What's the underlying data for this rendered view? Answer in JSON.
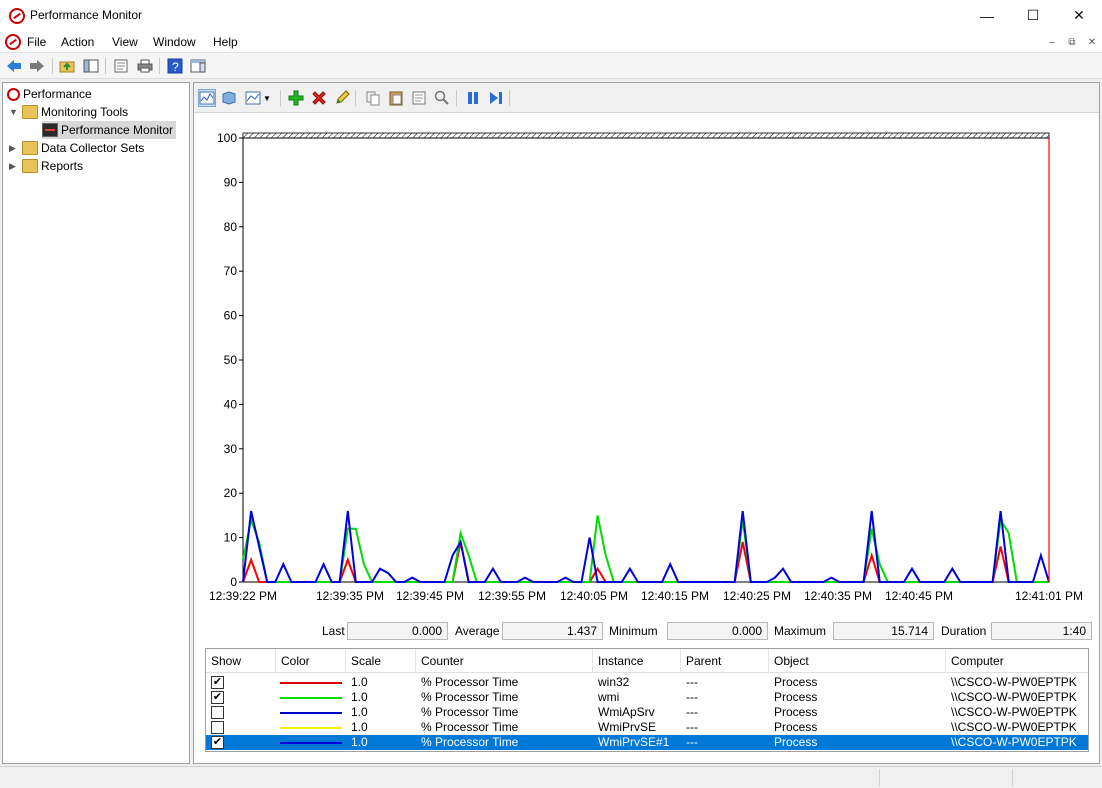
{
  "window": {
    "title": "Performance Monitor"
  },
  "menu": {
    "items": [
      "File",
      "Action",
      "View",
      "Window",
      "Help"
    ]
  },
  "tree": {
    "items": [
      {
        "label": "Performance"
      },
      {
        "label": "Monitoring Tools"
      },
      {
        "label": "Performance Monitor"
      },
      {
        "label": "Data Collector Sets"
      },
      {
        "label": "Reports"
      }
    ]
  },
  "chart_data": {
    "type": "line",
    "title": "",
    "xlabel": "",
    "ylabel": "",
    "ylim": [
      0,
      100
    ],
    "yticks": [
      0,
      10,
      20,
      30,
      40,
      50,
      60,
      70,
      80,
      90,
      100
    ],
    "xticks": [
      "12:39:22 PM",
      "12:39:35 PM",
      "12:39:45 PM",
      "12:39:55 PM",
      "12:40:05 PM",
      "12:40:15 PM",
      "12:40:25 PM",
      "12:40:35 PM",
      "12:40:45 PM",
      "12:41:01 PM"
    ],
    "grid": false,
    "series": [
      {
        "name": "win32",
        "color": "#ff0000",
        "values": [
          0,
          5,
          0,
          0,
          0,
          0,
          0,
          0,
          0,
          0,
          0,
          0,
          0,
          5,
          0,
          0,
          0,
          0,
          0,
          0,
          0,
          0,
          0,
          0,
          0,
          0,
          0,
          9,
          0,
          0,
          0,
          0,
          0,
          0,
          0,
          0,
          0,
          0,
          0,
          0,
          0,
          0,
          0,
          0,
          3,
          0,
          0,
          0,
          0,
          0,
          0,
          0,
          0,
          0,
          0,
          0,
          0,
          0,
          0,
          0,
          0,
          0,
          9,
          0,
          0,
          0,
          0,
          0,
          0,
          0,
          0,
          0,
          0,
          0,
          0,
          0,
          0,
          0,
          6,
          0,
          0,
          0,
          0,
          0,
          0,
          0,
          0,
          0,
          0,
          0,
          0,
          0,
          0,
          0,
          8,
          0,
          0,
          0,
          0,
          0,
          0
        ]
      },
      {
        "name": "wmi",
        "color": "#00dd00",
        "values": [
          5,
          14,
          9,
          0,
          0,
          0,
          0,
          0,
          0,
          0,
          0,
          0,
          0,
          12,
          12,
          4,
          0,
          0,
          0,
          0,
          0,
          0,
          0,
          0,
          0,
          0,
          0,
          11,
          6,
          0,
          0,
          0,
          0,
          0,
          0,
          0,
          0,
          0,
          0,
          0,
          0,
          0,
          0,
          0,
          15,
          6,
          0,
          0,
          0,
          0,
          0,
          0,
          0,
          0,
          0,
          0,
          0,
          0,
          0,
          0,
          0,
          0,
          14,
          0,
          0,
          0,
          0,
          0,
          0,
          0,
          0,
          0,
          0,
          0,
          0,
          0,
          0,
          0,
          12,
          4,
          0,
          0,
          0,
          0,
          0,
          0,
          0,
          0,
          0,
          0,
          0,
          0,
          0,
          0,
          14,
          11,
          0,
          0,
          0,
          0,
          0
        ]
      },
      {
        "name": "WmiApSrv",
        "color": "#0000cc",
        "visible": false,
        "values": []
      },
      {
        "name": "WmiPrvSE",
        "color": "#ffff00",
        "visible": false,
        "values": []
      },
      {
        "name": "WmiPrvSE#1",
        "color": "#0000dd",
        "values": [
          0,
          16,
          8,
          0,
          0,
          4,
          0,
          0,
          0,
          0,
          4,
          0,
          0,
          16,
          0,
          0,
          0,
          3,
          2,
          0,
          0,
          1,
          0,
          0,
          0,
          0,
          6,
          9,
          0,
          0,
          0,
          3,
          0,
          0,
          0,
          1,
          0,
          0,
          0,
          0,
          1,
          0,
          0,
          10,
          0,
          0,
          0,
          0,
          3,
          0,
          0,
          0,
          0,
          4,
          0,
          0,
          0,
          0,
          0,
          0,
          0,
          0,
          16,
          0,
          0,
          0,
          1,
          3,
          0,
          0,
          0,
          0,
          0,
          1,
          0,
          0,
          0,
          0,
          16,
          0,
          0,
          0,
          0,
          3,
          0,
          0,
          0,
          0,
          3,
          0,
          0,
          0,
          0,
          0,
          16,
          0,
          0,
          0,
          0,
          6,
          0
        ]
      }
    ]
  },
  "stats": {
    "last_label": "Last",
    "last": "0.000",
    "average_label": "Average",
    "average": "1.437",
    "minimum_label": "Minimum",
    "minimum": "0.000",
    "maximum_label": "Maximum",
    "maximum": "15.714",
    "duration_label": "Duration",
    "duration": "1:40"
  },
  "legend": {
    "columns": [
      "Show",
      "Color",
      "Scale",
      "Counter",
      "Instance",
      "Parent",
      "Object",
      "Computer"
    ],
    "rows": [
      {
        "show": "✔",
        "color": "#e00000",
        "scale": "1.0",
        "counter": "% Processor Time",
        "instance": "win32",
        "parent": "---",
        "object": "Process",
        "computer": "\\\\CSCO-W-PW0EPTPK"
      },
      {
        "show": "✔",
        "color": "#00e000",
        "scale": "1.0",
        "counter": "% Processor Time",
        "instance": "wmi",
        "parent": "---",
        "object": "Process",
        "computer": "\\\\CSCO-W-PW0EPTPK"
      },
      {
        "show": "",
        "color": "#0000cc",
        "scale": "1.0",
        "counter": "% Processor Time",
        "instance": "WmiApSrv",
        "parent": "---",
        "object": "Process",
        "computer": "\\\\CSCO-W-PW0EPTPK"
      },
      {
        "show": "",
        "color": "#f0f000",
        "scale": "1.0",
        "counter": "% Processor Time",
        "instance": "WmiPrvSE",
        "parent": "---",
        "object": "Process",
        "computer": "\\\\CSCO-W-PW0EPTPK"
      },
      {
        "show": "✔",
        "color": "#0000dd",
        "scale": "1.0",
        "counter": "% Processor Time",
        "instance": "WmiPrvSE#1",
        "parent": "---",
        "object": "Process",
        "computer": "\\\\CSCO-W-PW0EPTPK"
      }
    ]
  }
}
